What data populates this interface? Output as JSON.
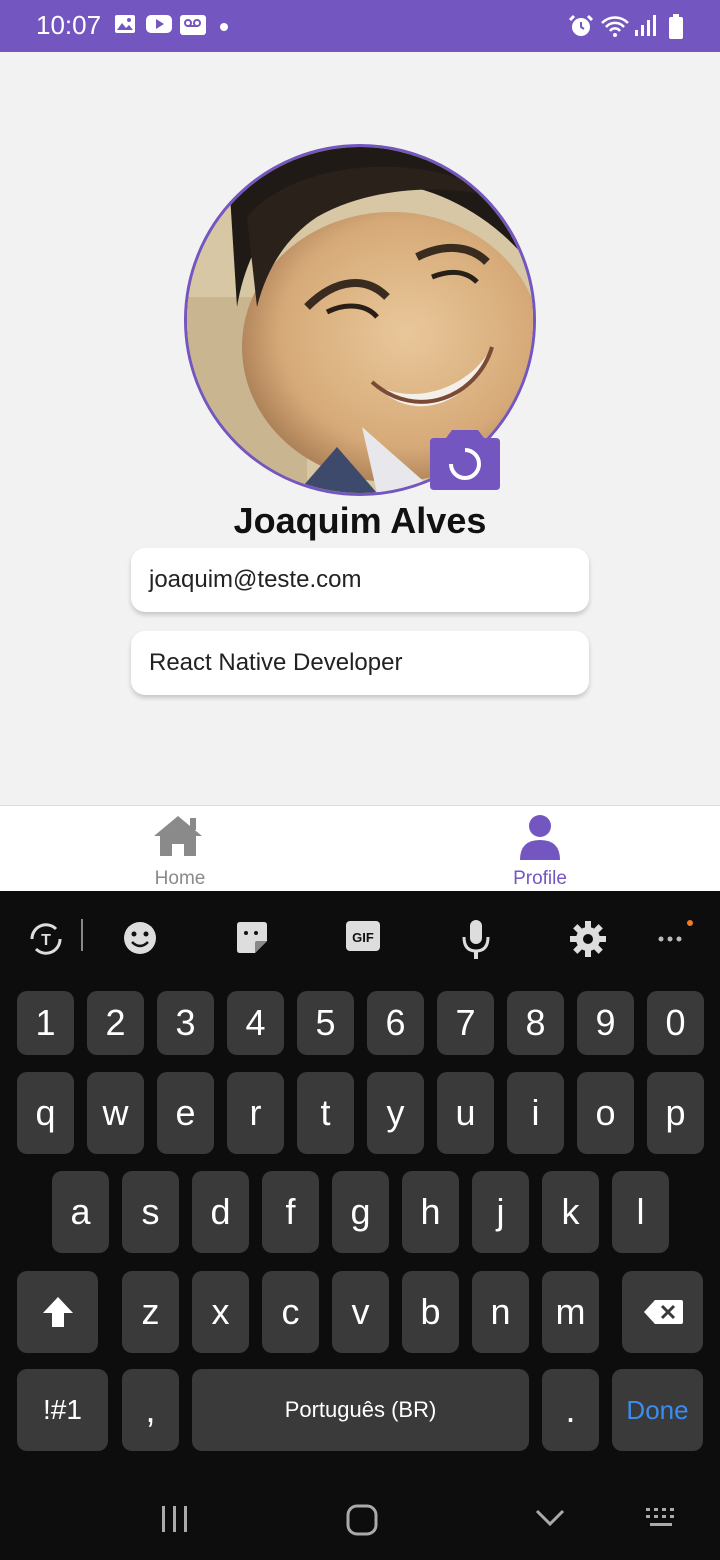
{
  "status_bar": {
    "time": "10:07",
    "left_icons": [
      "image-icon",
      "youtube-icon",
      "voicemail-icon",
      "dot"
    ],
    "right_icons": [
      "alarm-icon",
      "wifi-icon",
      "signal-icon",
      "battery-icon"
    ],
    "bg_color": "#7356c0"
  },
  "profile": {
    "name": "Joaquim Alves",
    "email": "joaquim@teste.com",
    "role": "React Native Developer",
    "camera_icon": "camera-icon"
  },
  "tabs": [
    {
      "label": "Home",
      "icon": "home-icon",
      "active": false
    },
    {
      "label": "Profile",
      "icon": "person-icon",
      "active": true
    }
  ],
  "colors": {
    "accent": "#7356c0",
    "inactive": "#8a8a8a"
  },
  "keyboard": {
    "toolbar": [
      "translate-icon",
      "emoji-icon",
      "sticker-icon",
      "gif-icon",
      "mic-icon",
      "settings-icon",
      "more-icon"
    ],
    "gif_label": "GIF",
    "number_row": [
      "1",
      "2",
      "3",
      "4",
      "5",
      "6",
      "7",
      "8",
      "9",
      "0"
    ],
    "row1": [
      "q",
      "w",
      "e",
      "r",
      "t",
      "y",
      "u",
      "i",
      "o",
      "p"
    ],
    "row2": [
      "a",
      "s",
      "d",
      "f",
      "g",
      "h",
      "j",
      "k",
      "l"
    ],
    "row3": [
      "z",
      "x",
      "c",
      "v",
      "b",
      "n",
      "m"
    ],
    "symbols_label": "!#1",
    "comma": ",",
    "space_label": "Português (BR)",
    "period": ".",
    "done_label": "Done"
  }
}
